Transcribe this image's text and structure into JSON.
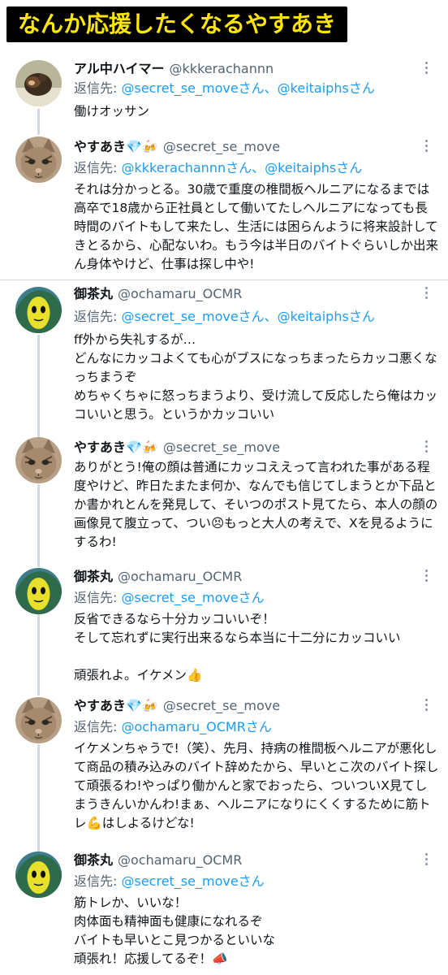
{
  "banner": {
    "title": "なんか応援したくなるやすあき"
  },
  "posts": [
    {
      "name": "アル中ハイマー",
      "handle": "@kkkerachannn",
      "reply_prefix": "返信先: ",
      "reply_to": "@secret_se_moveさん、@keitaiphsさん",
      "text": "働けオッサン",
      "avatar": "monkey-avatar"
    },
    {
      "name": "やすあき💎🍻",
      "handle": "@secret_se_move",
      "reply_prefix": "返信先: ",
      "reply_to": "@kkkerachannnさん、@keitaiphsさん",
      "text": "それは分かっとる。30歳で重度の椎間板ヘルニアになるまでは高卒で18歳から正社員として働いてたしヘルニアになっても長時間のバイトもして来たし、生活には困らんように将来設計してきとるから、心配ないわ。もう今は半日のバイトぐらいしか出来ん身体やけど、仕事は探し中や!",
      "avatar": "cat-avatar"
    },
    {
      "name": "御茶丸",
      "handle": "@ochamaru_OCMR",
      "reply_prefix": "返信先: ",
      "reply_to": "@secret_se_moveさん、@keitaiphsさん",
      "text": "ff外から失礼するが…\nどんなにカッコよくても心がブスになっちまったらカッコ悪くなっちまうぞ\nめちゃくちゃに怒っちまうより、受け流して反応したら俺はカッコいいと思う。というかカッコいい",
      "avatar": "alien-avatar"
    },
    {
      "name": "やすあき💎🍻",
      "handle": "@secret_se_move",
      "reply_prefix": "",
      "reply_to": "",
      "text": "ありがとう!俺の顔は普通にカッコええって言われた事がある程度やけど、昨日たまたま何か、なんでも信じてしまうとか下品とか書かれとんを発見して、そいつのポスト見てたら、本人の顔の画像見て腹立って、つい😣もっと大人の考えで、Xを見るようにするわ!",
      "avatar": "cat-avatar"
    },
    {
      "name": "御茶丸",
      "handle": "@ochamaru_OCMR",
      "reply_prefix": "返信先: ",
      "reply_to": "@secret_se_moveさん",
      "text": "反省できるなら十分カッコいいぞ！\nそして忘れずに実行出来るなら本当に十二分にカッコいい\n\n頑張れよ。イケメン👍",
      "avatar": "alien-avatar"
    },
    {
      "name": "やすあき💎🍻",
      "handle": "@secret_se_move",
      "reply_prefix": "返信先: ",
      "reply_to": "@ochamaru_OCMRさん",
      "text": "イケメンちゃうで!（笑）、先月、持病の椎間板ヘルニアが悪化して商品の積み込みのバイト辞めたから、早いとこ次のバイト探して頑張るわ!やっぱり働かんと家でおったら、ついついX見てしまうきんいかんわ!まぁ、ヘルニアになりにくくするために筋トレ💪はしよるけどな!",
      "avatar": "cat-avatar"
    },
    {
      "name": "御茶丸",
      "handle": "@ochamaru_OCMR",
      "reply_prefix": "返信先: ",
      "reply_to": "@secret_se_moveさん",
      "text": "筋トレか、いいな！\n肉体面も精神面も健康になれるぞ\nバイトも早いとこ見つかるといいな\n頑張れ！応援してるぞ！📣",
      "avatar": "alien-avatar"
    }
  ]
}
